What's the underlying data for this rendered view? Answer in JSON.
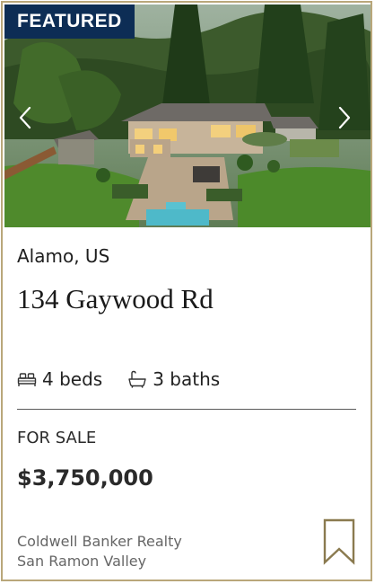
{
  "listing": {
    "badge": "FEATURED",
    "city": "Alamo, US",
    "address": "134 Gaywood Rd",
    "beds": "4 beds",
    "baths": "3 baths",
    "status": "FOR SALE",
    "price": "$3,750,000",
    "broker_line1": "Coldwell Banker Realty",
    "broker_line2": "San Ramon Valley"
  },
  "icons": {
    "prev": "chevron-left-icon",
    "next": "chevron-right-icon",
    "beds": "bed-icon",
    "baths": "bathtub-icon",
    "save": "bookmark-icon"
  },
  "colors": {
    "badge_bg": "#0d2d55",
    "card_border": "#b9a77a",
    "bookmark": "#8a7a4f"
  }
}
